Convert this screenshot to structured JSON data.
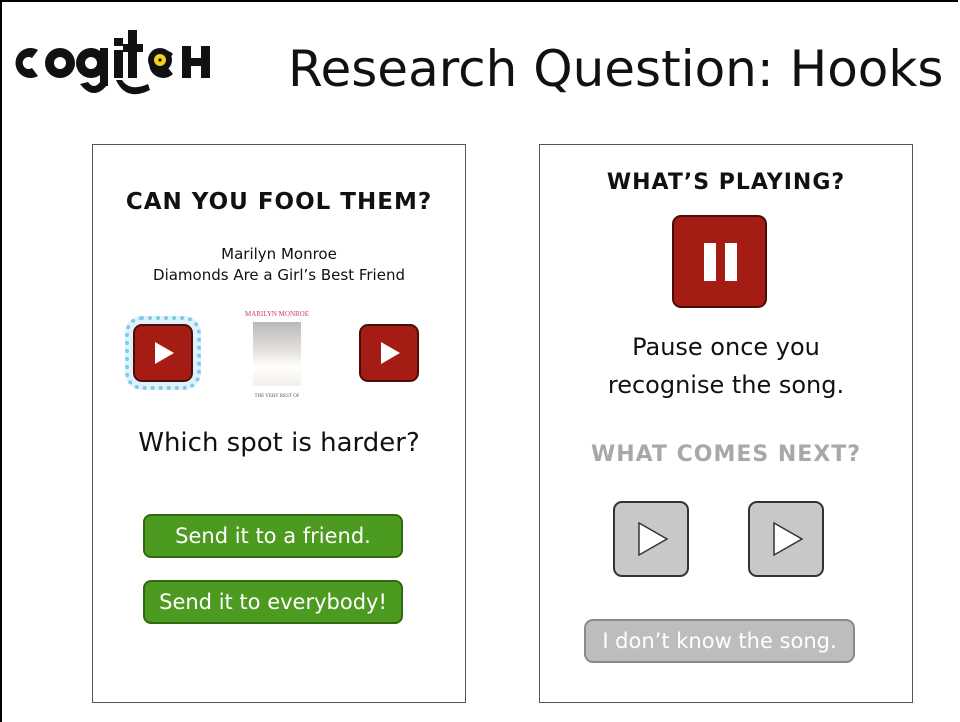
{
  "slide": {
    "title": "Research Question: Hooks",
    "logo_text": "cogitch"
  },
  "left_panel": {
    "heading": "CAN YOU FOOL THEM?",
    "artist": "Marilyn Monroe",
    "song": "Diamonds Are a Girl’s Best Friend",
    "album_top_text": "MARILYN MONROE",
    "album_bottom_text": "THE VERY BEST OF",
    "question": "Which spot is harder?",
    "send_friend_label": "Send it to a friend.",
    "send_everybody_label": "Send it to everybody!"
  },
  "right_panel": {
    "heading": "WHAT’S PLAYING?",
    "instruction_line1": "Pause once you",
    "instruction_line2": "recognise the song.",
    "next_heading": "WHAT COMES NEXT?",
    "dont_know_label": "I don’t know the song."
  },
  "icons": {
    "play": "play-icon",
    "pause": "pause-icon",
    "vinyl": "vinyl-record-icon"
  },
  "colors": {
    "red_button": "#a51c14",
    "green_button": "#4c9a20",
    "gray_button": "#c8c8c8",
    "highlight": "#7ec9ec",
    "logo_yellow": "#f2d21a"
  }
}
